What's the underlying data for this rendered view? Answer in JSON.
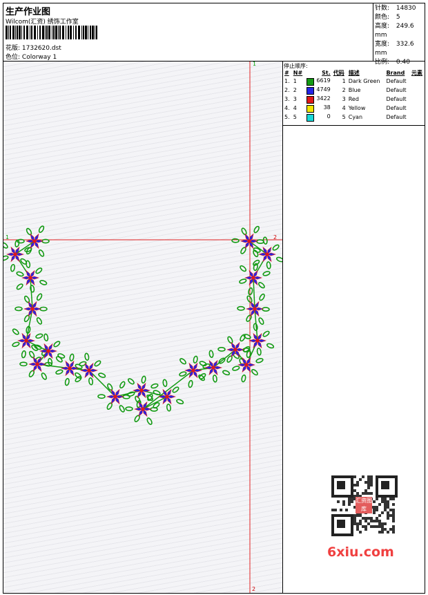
{
  "header": {
    "title": "生产作业图",
    "company": "Wilcom(汇资) 绣饰工作室",
    "design_label": "花版:",
    "design_value": "1732620.dst",
    "colorway_label": "色位:",
    "colorway_value": "Colorway 1"
  },
  "stats": [
    {
      "label": "针数:",
      "value": "14830"
    },
    {
      "label": "颜色:",
      "value": "5"
    },
    {
      "label": "高度:",
      "value": "249.6 mm"
    },
    {
      "label": "宽度:",
      "value": "332.6 mm"
    },
    {
      "label": "比例:",
      "value": "0.40"
    }
  ],
  "stop_table": {
    "title": "停止顺序:",
    "headers": [
      "#",
      "N#",
      "St.",
      "代码",
      "描述",
      "Brand",
      "元素"
    ],
    "rows": [
      {
        "idx": "1.",
        "n": "1",
        "color": "#139a13",
        "st": "6619",
        "code": "1",
        "desc": "Dark Green",
        "brand": "Default"
      },
      {
        "idx": "2.",
        "n": "2",
        "color": "#2424e6",
        "st": "4749",
        "code": "2",
        "desc": "Blue",
        "brand": "Default"
      },
      {
        "idx": "3.",
        "n": "3",
        "color": "#e11818",
        "st": "3422",
        "code": "3",
        "desc": "Red",
        "brand": "Default"
      },
      {
        "idx": "4.",
        "n": "4",
        "color": "#f2e600",
        "st": "38",
        "code": "4",
        "desc": "Yellow",
        "brand": "Default"
      },
      {
        "idx": "5.",
        "n": "5",
        "color": "#18d8d8",
        "st": "0",
        "code": "5",
        "desc": "Cyan",
        "brand": "Default"
      }
    ]
  },
  "markers": {
    "top": "1",
    "left": "1",
    "right": "2",
    "bottom": "2"
  },
  "colors": {
    "guide_line": "#e02020",
    "leaf": "#139a13",
    "petal": "#2424e6",
    "center": "#e11818"
  },
  "watermark": "6xiu.com",
  "qr_stamp": "汇资图库"
}
